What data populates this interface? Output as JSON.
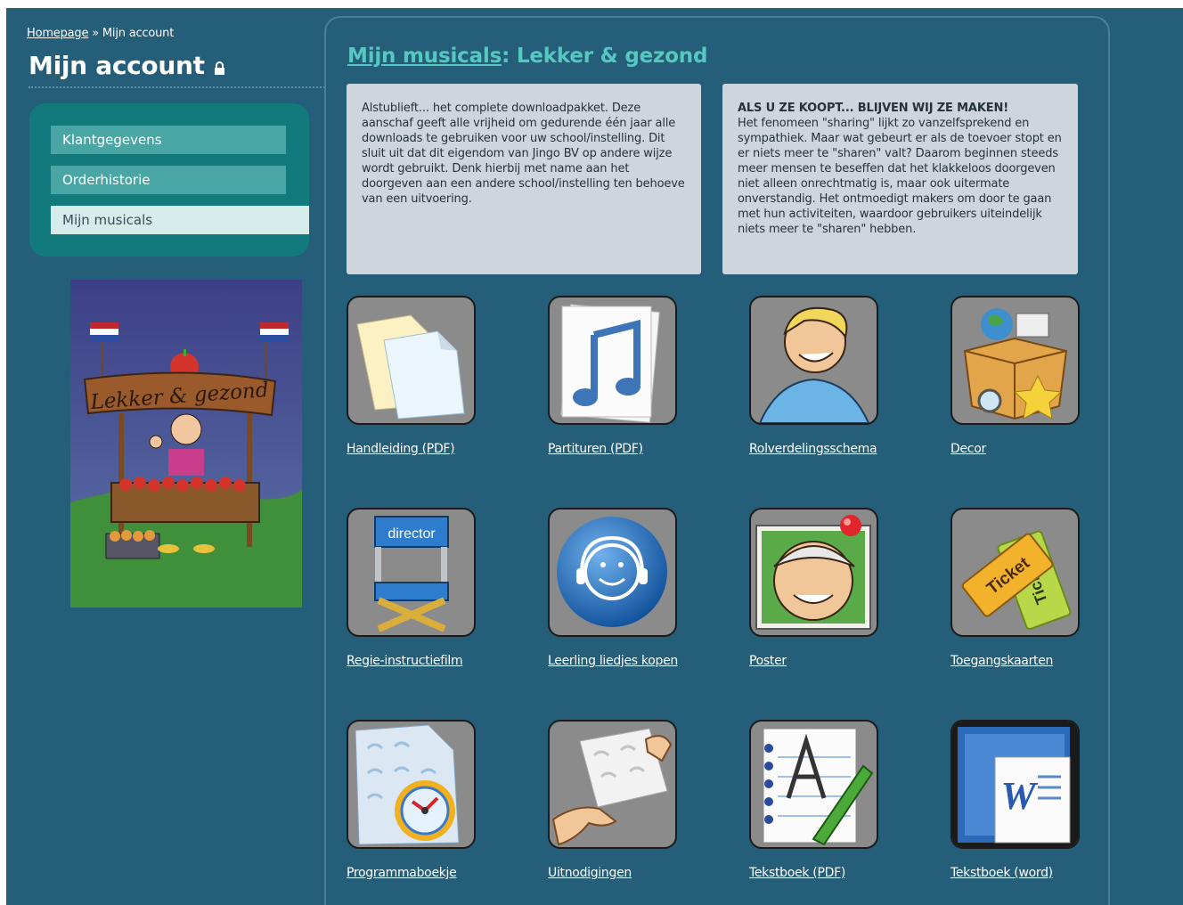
{
  "breadcrumb": {
    "home": "Homepage",
    "sep": " » ",
    "current": "Mijn account"
  },
  "sidebar": {
    "title": "Mijn account",
    "menu": [
      {
        "label": "Klantgegevens"
      },
      {
        "label": "Orderhistorie"
      },
      {
        "label": "Mijn musicals"
      }
    ]
  },
  "main": {
    "title_link": "Mijn musicals",
    "title_rest": ": Lekker & gezond",
    "box_left": "Alstublieft... het complete downloadpakket. Deze aanschaf geeft alle vrijheid om gedurende één jaar alle downloads te gebruiken voor uw school/instelling. Dit sluit uit dat dit eigendom van Jingo BV op andere wijze wordt gebruikt. Denk hierbij met name aan het doorgeven aan een andere school/instelling ten behoeve van een uitvoering.",
    "box_right_heading": "ALS U ZE KOOPT... BLIJVEN WIJ ZE MAKEN!",
    "box_right_text": "Het fenomeen \"sharing\" lijkt zo vanzelfsprekend en sympathiek. Maar wat gebeurt er als de toevoer stopt en er niets meer te \"sharen\" valt? Daarom beginnen steeds meer mensen te beseffen dat het klakkeloos doorgeven niet alleen onrechtmatig is, maar ook uitermate onverstandig. Het ontmoedigt makers om door te gaan met hun activiteiten, waardoor gebruikers uiteindelijk niets meer te \"sharen\" hebben."
  },
  "downloads": [
    {
      "label": "Handleiding (PDF)",
      "icon": "documents-icon"
    },
    {
      "label": "Partituren (PDF)",
      "icon": "music-note-icon"
    },
    {
      "label": "Rolverdelingsschema",
      "icon": "character-icon"
    },
    {
      "label": "Decor",
      "icon": "box-icon"
    },
    {
      "label": "Regie-instructiefilm",
      "icon": "director-chair-icon"
    },
    {
      "label": "Leerling liedjes kopen",
      "icon": "smiley-headphones-icon"
    },
    {
      "label": "Poster",
      "icon": "poster-icon"
    },
    {
      "label": "Toegangskaarten",
      "icon": "ticket-icon"
    },
    {
      "label": "Programmaboekje",
      "icon": "program-clock-icon"
    },
    {
      "label": "Uitnodigingen",
      "icon": "invitation-hands-icon"
    },
    {
      "label": "Tekstboek (PDF)",
      "icon": "notebook-pen-icon"
    },
    {
      "label": "Tekstboek (word)",
      "icon": "word-document-icon"
    }
  ],
  "poster_image": {
    "sign_text": "Lekker & gezond"
  },
  "icon_texts": {
    "director": "director",
    "ticket": "Ticket",
    "ticket_back": "Tick",
    "word": "W"
  }
}
